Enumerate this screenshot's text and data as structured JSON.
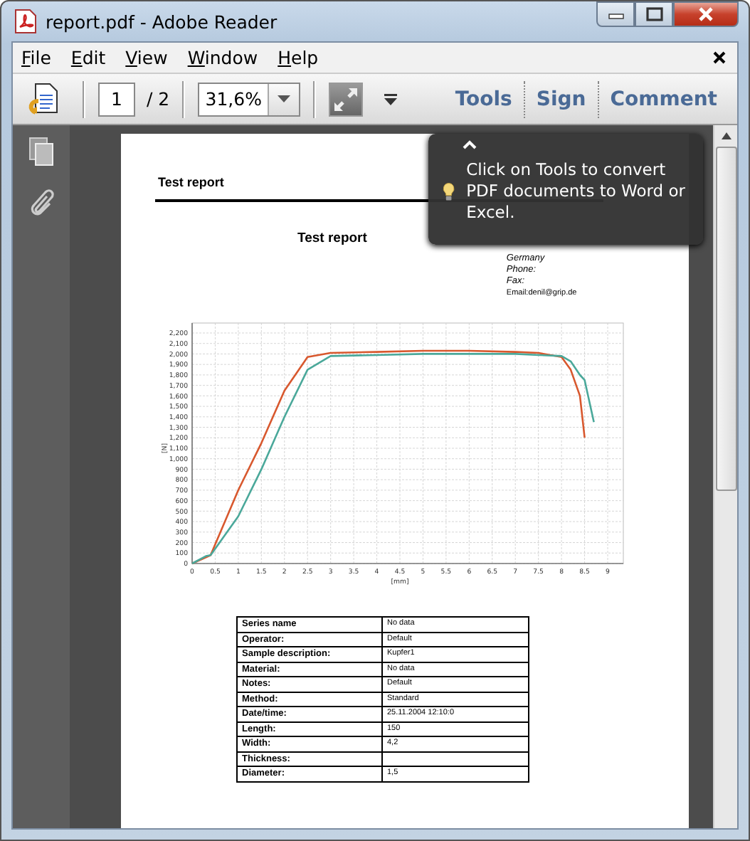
{
  "window": {
    "title": "report.pdf - Adobe Reader"
  },
  "menu": [
    {
      "label": "File"
    },
    {
      "label": "Edit"
    },
    {
      "label": "View"
    },
    {
      "label": "Window"
    },
    {
      "label": "Help"
    }
  ],
  "toolbar": {
    "page_number": "1",
    "page_count": "/ 2",
    "zoom": "31,6%",
    "panels": [
      "Tools",
      "Sign",
      "Comment"
    ]
  },
  "tooltip": {
    "text": "Click on Tools to convert PDF documents to Word or Excel."
  },
  "document": {
    "header_title": "Test report",
    "title": "Test report",
    "address": [
      "Germany",
      "Phone:",
      "Fax:",
      "Email:denil@grip.de"
    ],
    "chart_data": {
      "type": "line",
      "xlabel": "[mm]",
      "ylabel": "[N]",
      "x": [
        0,
        0.3,
        0.4,
        1,
        1.5,
        2,
        2.5,
        3,
        4,
        5,
        6,
        7,
        7.5,
        8,
        8.2,
        8.4,
        8.5,
        8.7
      ],
      "series": [
        {
          "color": "#d8582e",
          "values": [
            0,
            60,
            80,
            700,
            1150,
            1650,
            1970,
            2010,
            2020,
            2030,
            2030,
            2020,
            2010,
            1970,
            1850,
            1600,
            1200,
            null
          ]
        },
        {
          "color": "#4aa89a",
          "values": [
            0,
            70,
            80,
            450,
            900,
            1400,
            1850,
            1980,
            1990,
            2000,
            2000,
            2000,
            1990,
            1980,
            1930,
            1800,
            1750,
            1350
          ]
        }
      ],
      "grid": true,
      "xlim": [
        0,
        9
      ],
      "ylim": [
        0,
        2200
      ],
      "xticks": [
        0,
        0.5,
        1,
        1.5,
        2,
        2.5,
        3,
        3.5,
        4,
        4.5,
        5,
        5.5,
        6,
        6.5,
        7,
        7.5,
        8,
        8.5,
        9
      ],
      "yticks": [
        0,
        100,
        200,
        300,
        400,
        500,
        600,
        700,
        800,
        900,
        {
          "value": 1000,
          "label": "1,000"
        },
        {
          "value": 1100,
          "label": "1,100"
        },
        {
          "value": 1200,
          "label": "1,200"
        },
        {
          "value": 1300,
          "label": "1,300"
        },
        {
          "value": 1400,
          "label": "1,400"
        },
        {
          "value": 1500,
          "label": "1,500"
        },
        {
          "value": 1600,
          "label": "1,600"
        },
        {
          "value": 1700,
          "label": "1,700"
        },
        {
          "value": 1800,
          "label": "1,800"
        },
        {
          "value": 1900,
          "label": "1,900"
        },
        {
          "value": 2000,
          "label": "2,000"
        },
        {
          "value": 2100,
          "label": "2,100"
        },
        {
          "value": 2200,
          "label": "2,200"
        }
      ]
    },
    "table": {
      "rows": [
        {
          "label": "Series name",
          "value": "No data"
        },
        {
          "label": "Operator:",
          "value": "Default"
        },
        {
          "label": "Sample description:",
          "value": "Kupfer1"
        },
        {
          "label": "Material:",
          "value": "No data"
        },
        {
          "label": "Notes:",
          "value": "Default"
        },
        {
          "label": "Method:",
          "value": "Standard"
        },
        {
          "label": "Date/time:",
          "value": "25.11.2004   12:10:0"
        },
        {
          "label": "Length:",
          "value": "150"
        },
        {
          "label": "Width:",
          "value": "4,2"
        },
        {
          "label": "Thickness:"
        },
        {
          "label": "Diameter:",
          "value": "1,5"
        }
      ]
    }
  }
}
